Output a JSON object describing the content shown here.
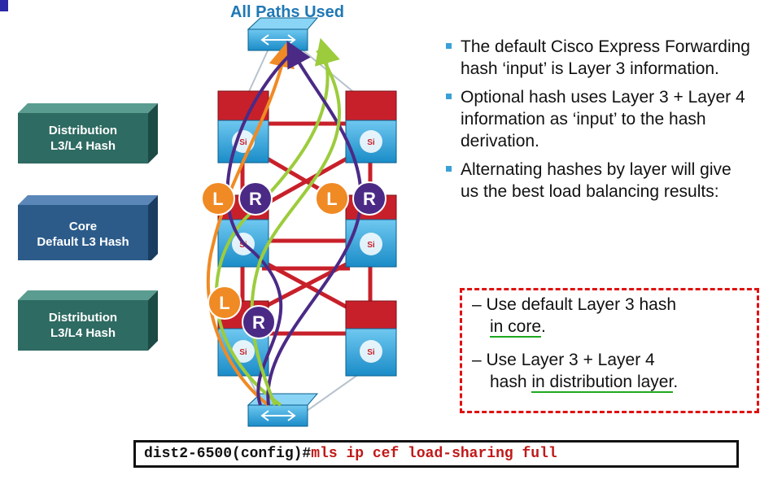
{
  "title": "All Paths Used",
  "layers": [
    {
      "line1": "Distribution",
      "line2": "L3/L4 Hash",
      "color": "#2e6b62"
    },
    {
      "line1": "Core",
      "line2": "Default L3 Hash",
      "color": "#2c5b8a"
    },
    {
      "line1": "Distribution",
      "line2": "L3/L4 Hash",
      "color": "#2e6b62"
    }
  ],
  "node_labels": {
    "left": "L",
    "right": "R",
    "switch_badge": "Si"
  },
  "bullets": [
    "The default Cisco Express Forwarding hash ‘input’ is Layer 3 information.",
    "Optional hash uses Layer 3 + Layer 4 information as ‘input’ to the hash derivation.",
    "Alternating hashes by layer will give us the best load balancing results:"
  ],
  "sub_bullets": {
    "first_a": "– Use default Layer 3 hash",
    "first_b": "in core",
    "first_c": ".",
    "second_a": "– Use Layer 3 + Layer 4",
    "second_b": "hash ",
    "second_c": "in distribution layer",
    "second_d": "."
  },
  "command": {
    "prompt": "dist2-6500(config)#",
    "text": "mls ip cef load-sharing full"
  },
  "colors": {
    "orange": "#f08a24",
    "green": "#9ccc3c",
    "purple": "#4b2a86",
    "link_red": "#c8202a",
    "switch_blue": "#1e9cd8"
  }
}
